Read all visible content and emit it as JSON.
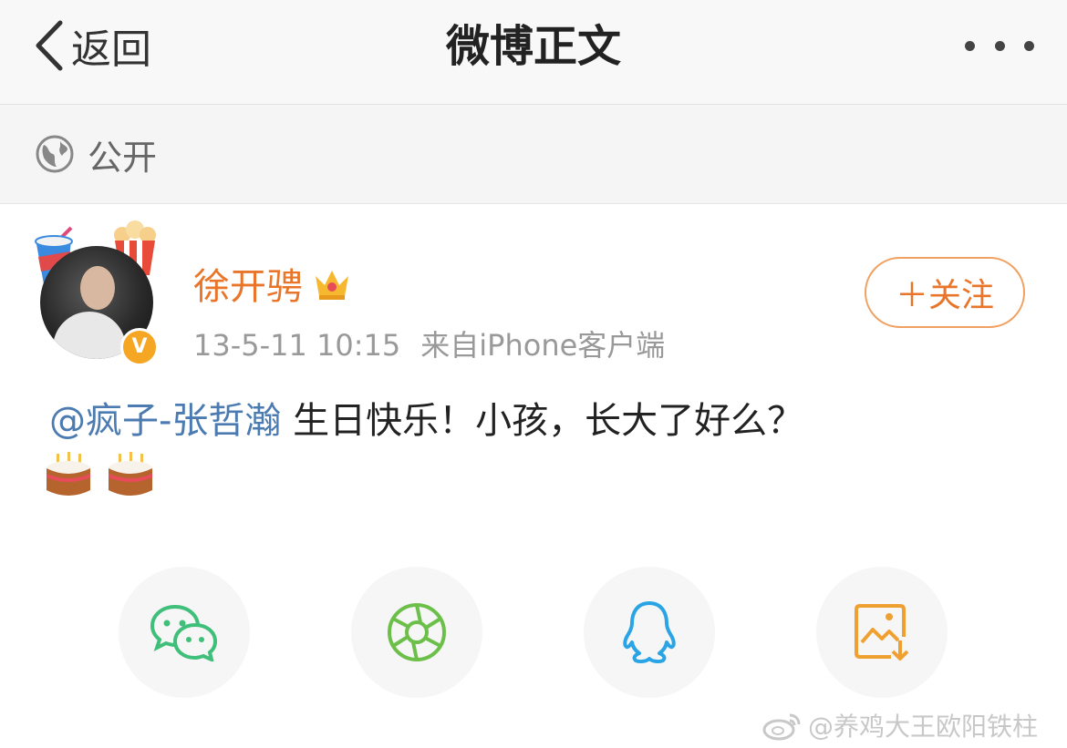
{
  "header": {
    "back_label": "返回",
    "title": "微博正文"
  },
  "visibility": {
    "label": "公开"
  },
  "post": {
    "author": "徐开骋",
    "timestamp": "13-5-11 10:15",
    "source": "来自iPhone客户端",
    "follow_label": "＋关注",
    "mention": "@疯子-张哲瀚",
    "text": " 生日快乐！小孩，长大了好么？",
    "verified_badge": "V"
  },
  "share": {
    "icons": [
      "wechat-icon",
      "moments-icon",
      "qq-icon",
      "save-image-icon"
    ]
  },
  "watermark": {
    "text": "@养鸡大王欧阳铁柱"
  },
  "colors": {
    "accent": "#e8752a",
    "mention": "#4b7bb0",
    "wechat": "#3fbf7a",
    "moments": "#6cc04a",
    "qq": "#2ba4e6",
    "save": "#f0a030"
  }
}
